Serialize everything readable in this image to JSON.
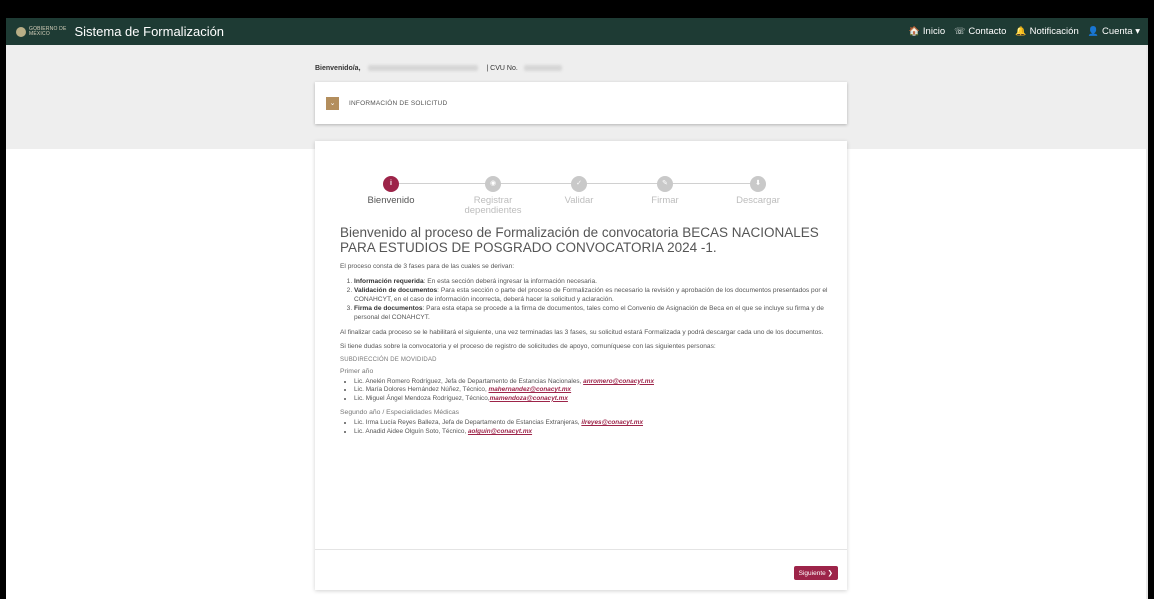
{
  "nav": {
    "gov_logo_line1": "GOBIERNO DE",
    "gov_logo_line2": "MÉXICO",
    "app_title": "Sistema de Formalización",
    "links": [
      {
        "icon": "home-icon",
        "glyph": "🏠",
        "label": "Inicio"
      },
      {
        "icon": "contact-icon",
        "glyph": "☏",
        "label": "Contacto"
      },
      {
        "icon": "bell-icon",
        "glyph": "🔔",
        "label": "Notificación"
      },
      {
        "icon": "user-icon",
        "glyph": "👤",
        "label": "Cuenta ▾"
      }
    ]
  },
  "header": {
    "welcome_label": "Bienvenido/a,",
    "cvu_label": "|   CVU No."
  },
  "info_card": {
    "label": "INFORMACIÓN DE SOLICITUD"
  },
  "steps": [
    {
      "label": "Bienvenido",
      "icon": "info-icon",
      "glyph": "i",
      "active": true
    },
    {
      "label": "Registrar dependientes",
      "icon": "people-icon",
      "glyph": "◉",
      "active": false
    },
    {
      "label": "Validar",
      "icon": "check-icon",
      "glyph": "✓",
      "active": false
    },
    {
      "label": "Firmar",
      "icon": "pencil-icon",
      "glyph": "✎",
      "active": false
    },
    {
      "label": "Descargar",
      "icon": "download-icon",
      "glyph": "⬇",
      "active": false
    }
  ],
  "content": {
    "heading": "Bienvenido al proceso de Formalización de convocatoria BECAS NACIONALES PARA ESTUDIOS DE POSGRADO CONVOCATORIA 2024 -1.",
    "intro": "El proceso consta de 3 fases para de las cuales se derivan:",
    "phases": [
      {
        "title": "Información requerida",
        "text": ": En esta sección deberá ingresar la información necesaria."
      },
      {
        "title": "Validación de documentos",
        "text": ": Para esta sección o parte del proceso de Formalización es necesario la revisión y aprobación de los documentos presentados por el CONAHCYT, en el caso de información incorrecta, deberá hacer la solicitud y aclaración."
      },
      {
        "title": "Firma de documentos",
        "text": ": Para esta etapa se procede a la firma de documentos, tales como el Convenio de Asignación de Beca en el que se incluye su firma y de personal del CONAHCYT."
      }
    ],
    "finish_text": "Al finalizar cada proceso se le habilitará el siguiente, una vez terminadas las 3 fases, su solicitud estará Formalizada y podrá descargar cada uno de los documentos.",
    "doubts_text": "Si tiene dudas sobre la convocatoria y el proceso de registro de solicitudes de apoyo, comuníquese con las siguientes personas:",
    "subdireccion": "SUBDIRECCIÓN DE MOVIDIDAD",
    "year1_label": "Primer año",
    "year1_contacts": [
      {
        "text": "Lic. Anelén Romero Rodríguez, Jefa de Departamento de Estancias Nacionales, ",
        "email": "anromero@conacyt.mx"
      },
      {
        "text": "Lic. María Dolores Hernández Núñez, Técnico, ",
        "email": "mahernandez@conacyt.mx"
      },
      {
        "text": "Lic. Miguel Ángel Mendoza Rodríguez, Técnico,",
        "email": "mamendoza@conacyt.mx"
      }
    ],
    "year2_label": "Segundo año / Especialidades Médicas",
    "year2_contacts": [
      {
        "text": "Lic. Irma Lucía Reyes Balleza, Jefa de Departamento de Estancias Extranjeras, ",
        "email": "ilreyes@conacyt.mx"
      },
      {
        "text": "Lic. Anadid Aidee Olguín Soto, Técnico, ",
        "email": "aolguin@conacyt.mx"
      }
    ]
  },
  "footer": {
    "next_label": "Siguiente ❯"
  },
  "colors": {
    "nav_bg": "#1e3b34",
    "accent": "#9d2449",
    "gold": "#b38e5d"
  }
}
